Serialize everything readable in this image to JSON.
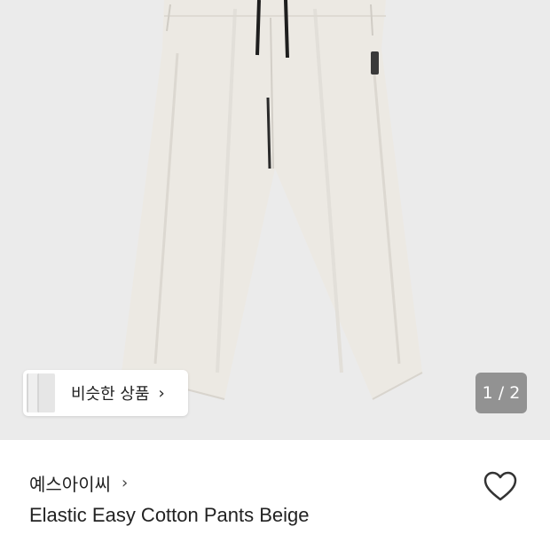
{
  "similar_products": {
    "label": "비슷한 상품",
    "chevron": "›"
  },
  "pager": {
    "current": 1,
    "total": 2,
    "text": "1 / 2"
  },
  "brand": {
    "name": "예스아이씨",
    "chevron": "›"
  },
  "product": {
    "title": "Elastic Easy Cotton Pants Beige"
  },
  "icons": {
    "wishlist": "heart-icon"
  },
  "colors": {
    "photo_background": "#ebebeb",
    "pants": "#ece9e3",
    "drawstring": "#1e1e1e"
  }
}
